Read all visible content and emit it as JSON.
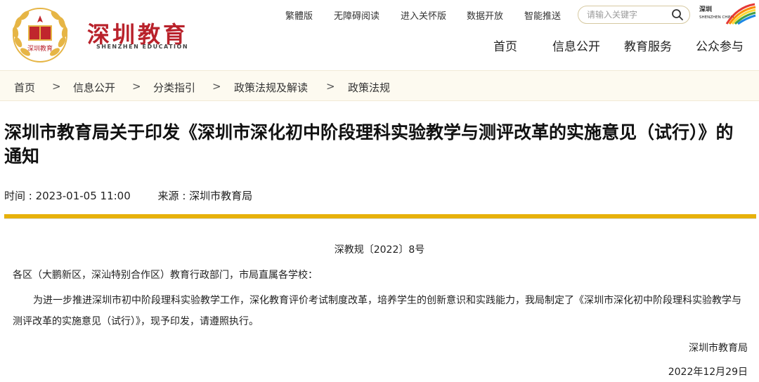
{
  "header": {
    "logo_title": "深圳教育",
    "logo_subtitle": "SHENZHEN EDUCATION",
    "emblem_inner_text": "深圳教育",
    "top_links": [
      "繁體版",
      "无障碍阅读",
      "进入关怀版",
      "数据开放",
      "智能推送"
    ],
    "search_placeholder": "请输入关键字",
    "sz_china_logo": "深圳 SHENZHEN CHINA",
    "nav": [
      "首页",
      "信息公开",
      "教育服务",
      "公众参与"
    ]
  },
  "breadcrumb": {
    "items": [
      "首页",
      "信息公开",
      "分类指引",
      "政策法规及解读",
      "政策法规"
    ],
    "separator": ">"
  },
  "article": {
    "title": "深圳市教育局关于印发《深圳市深化初中阶段理科实验教学与测评改革的实施意见（试行）》的通知",
    "time_label": "时间 : 2023-01-05 11:00",
    "source_label": "来源 : 深圳市教育局",
    "doc_number": "深教规〔2022〕8号",
    "recipients": "各区（大鹏新区，深汕特别合作区）教育行政部门，市局直属各学校：",
    "body": "为进一步推进深圳市初中阶段理科实验教学工作，深化教育评价考试制度改革，培养学生的创新意识和实践能力，我局制定了《深圳市深化初中阶段理科实验教学与测评改革的实施意见（试行）》，现予印发，请遵照执行。",
    "signer": "深圳市教育局",
    "sign_date": "2022年12月29日"
  },
  "colors": {
    "brand_red": "#b9222b",
    "accent_gold": "#e7b10a",
    "breadcrumb_bg": "#fdfaf0"
  }
}
